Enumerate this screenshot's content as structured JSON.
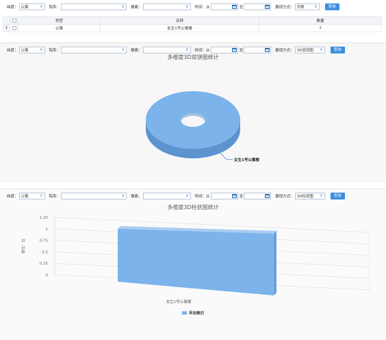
{
  "panels": [
    {
      "filter": {
        "dim_label": "纬度：",
        "dim_value": "公寓",
        "college_label": "院系：",
        "college_value": "",
        "building_label": "楼离：",
        "building_value": "",
        "time_label": "时间：从",
        "to_label": "至",
        "view_label": "展现方式：",
        "view_value": "列表",
        "query_label": "查询"
      },
      "table": {
        "columns": [
          "类型",
          "名称",
          "数量"
        ],
        "rows": [
          {
            "index": "1",
            "type": "公寓",
            "name": "女生1号公寓楼",
            "count": "1"
          }
        ]
      }
    },
    {
      "filter": {
        "dim_label": "纬度：",
        "dim_value": "公寓",
        "college_label": "院系：",
        "college_value": "",
        "building_label": "楼离：",
        "building_value": "",
        "time_label": "时间：从",
        "to_label": "至",
        "view_label": "展现方式：",
        "view_value": "3D双饼图",
        "query_label": "查询"
      },
      "chart_title": "多维度3D双饼图统计"
    },
    {
      "filter": {
        "dim_label": "纬度：",
        "dim_value": "公寓",
        "college_label": "院系：",
        "college_value": "",
        "building_label": "楼离：",
        "building_value": "",
        "time_label": "时间：从",
        "to_label": "至",
        "view_label": "展现方式：",
        "view_value": "3D柱状图",
        "query_label": "查询"
      },
      "chart_title": "多维度3D柱状图统计"
    }
  ],
  "chart_data": [
    {
      "type": "pie",
      "title": "多维度3D双饼图统计",
      "slices": [
        {
          "label": "女生1号公寓楼",
          "value": 1
        }
      ],
      "colors": {
        "top": "#7cb3ea",
        "side": "#5d93cf"
      }
    },
    {
      "type": "bar",
      "title": "多维度3D柱状图统计",
      "categories": [
        "女生1号公寓楼"
      ],
      "series": [
        {
          "name": "早出晚归",
          "values": [
            1
          ]
        }
      ],
      "ylabel": "单位：位",
      "yticks": [
        "0",
        "0.25",
        "0.5",
        "0.75",
        "1",
        "1.25"
      ],
      "ylim": [
        0,
        1.25
      ],
      "legend": "bottom",
      "colors": {
        "front": "#7cb3ea",
        "side": "#6aa1dc",
        "top": "#a9cdf2"
      }
    }
  ]
}
